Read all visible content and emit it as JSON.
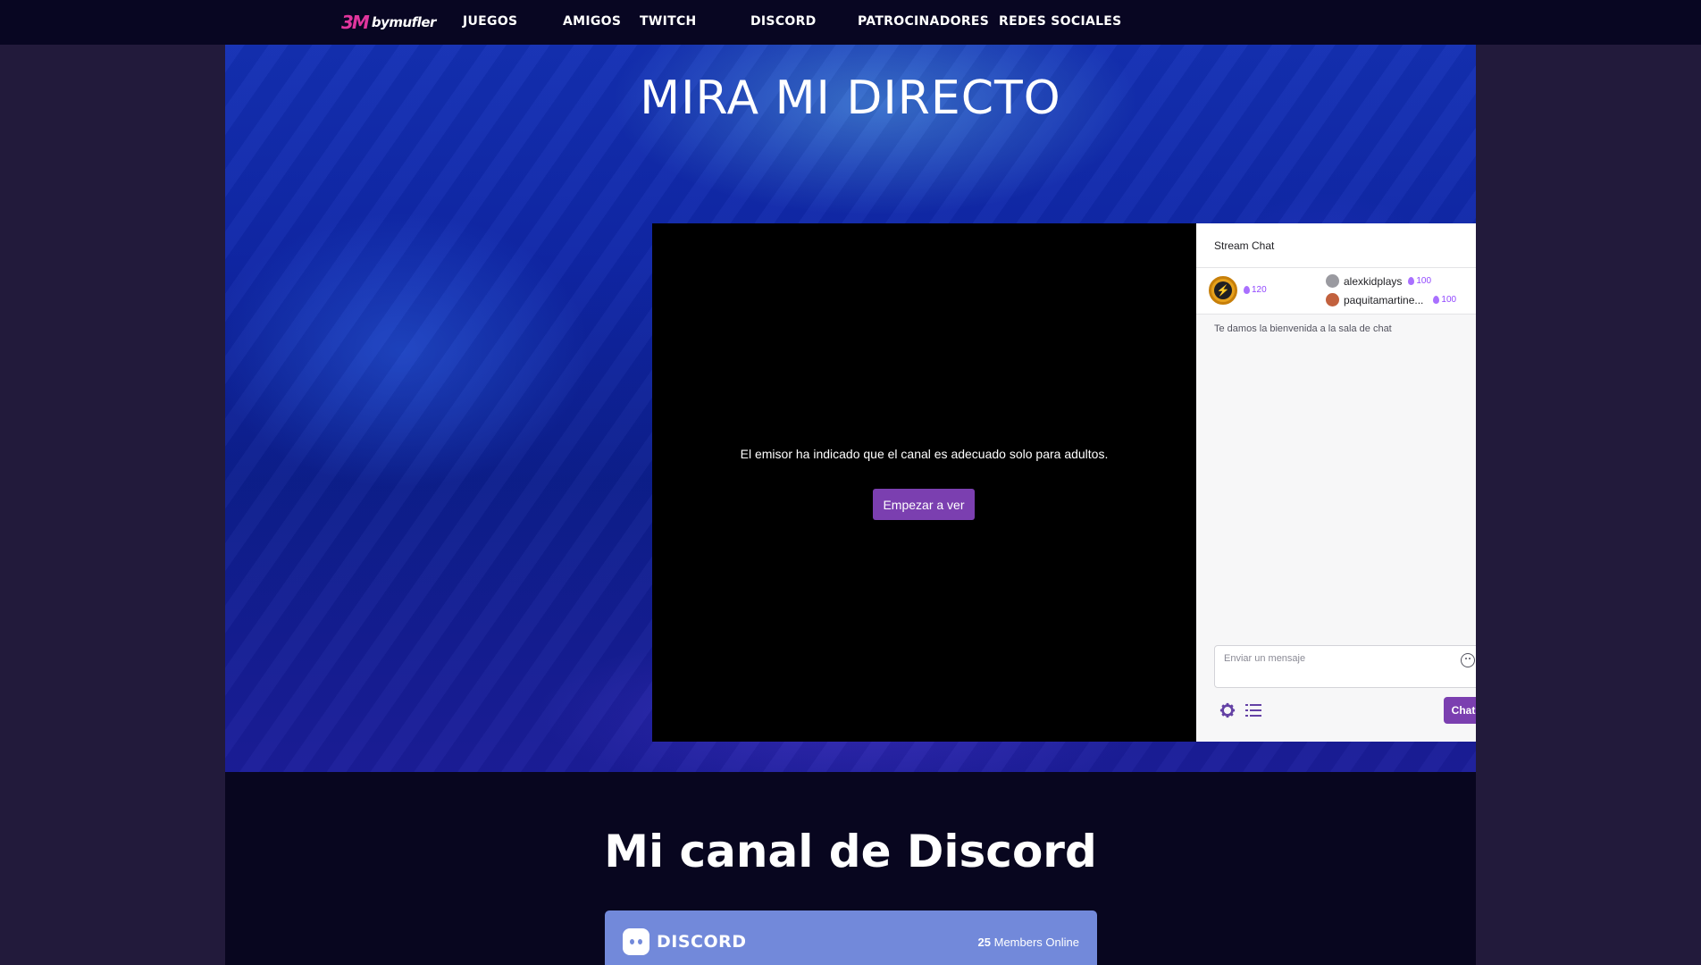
{
  "nav": {
    "logo_mark": "3M",
    "logo_text": "bymufler",
    "items": [
      {
        "label": "JUEGOS"
      },
      {
        "label": "AMIGOS"
      },
      {
        "label": "TWITCH"
      },
      {
        "label": "DISCORD"
      },
      {
        "label": "PATROCINADORES"
      },
      {
        "label": "REDES SOCIALES"
      }
    ]
  },
  "hero": {
    "title": "MIRA MI DIRECTO"
  },
  "player": {
    "message": "El emisor ha indicado que el canal es adecuado solo para adultos.",
    "button_label": "Empezar a ver"
  },
  "chat": {
    "header": "Stream Chat",
    "leaderboard": {
      "top_points": "120",
      "entries": [
        {
          "name": "alexkidplays",
          "points": "100"
        },
        {
          "name": "paquitamartine...",
          "points": "100"
        }
      ]
    },
    "welcome": "Te damos la bienvenida a la sala de chat",
    "input_placeholder": "Enviar un mensaje",
    "send_label": "Chat"
  },
  "discord": {
    "title": "Mi canal de Discord",
    "widget_logo": "DISCORD",
    "members_count": "25",
    "members_label": "Members Online"
  },
  "colors": {
    "nav_bg": "#080622",
    "accent_purple": "#7b3fb0",
    "discord_blurple": "#7289da"
  }
}
